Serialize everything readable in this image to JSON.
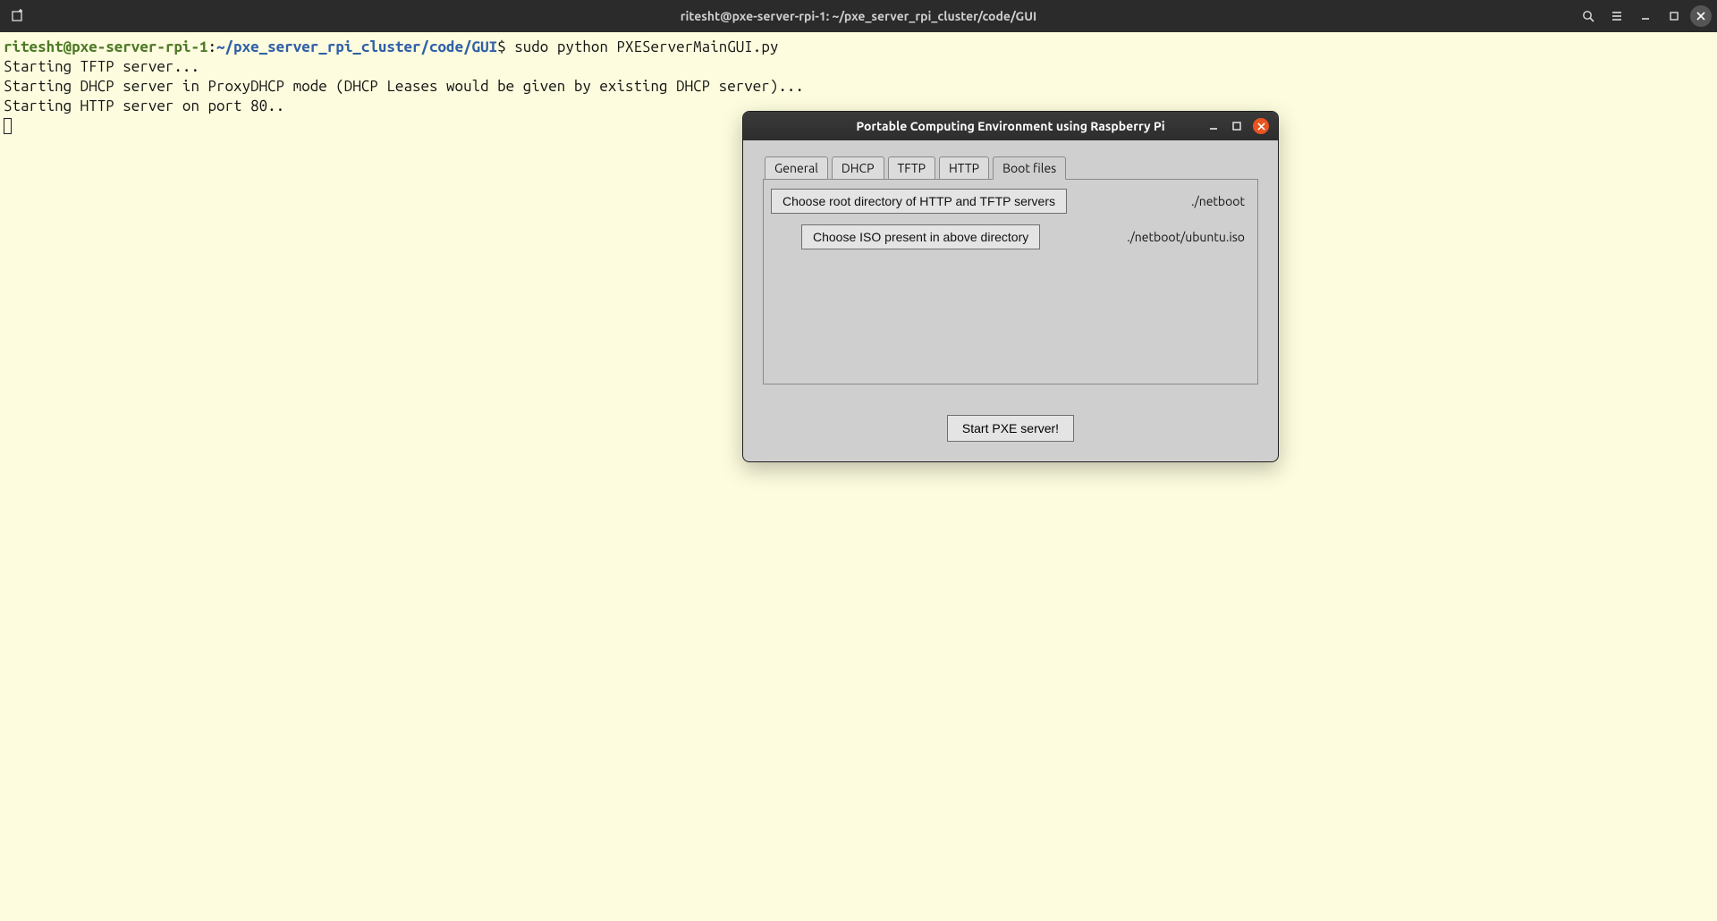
{
  "terminal": {
    "title": "ritesht@pxe-server-rpi-1: ~/pxe_server_rpi_cluster/code/GUI",
    "prompt_user": "ritesht@pxe-server-rpi-1",
    "prompt_sep": ":",
    "prompt_path": "~/pxe_server_rpi_cluster/code/GUI",
    "prompt_symbol": "$",
    "command": " sudo python PXEServerMainGUI.py",
    "lines": [
      "Starting TFTP server...",
      "Starting DHCP server in ProxyDHCP mode (DHCP Leases would be given by existing DHCP server)...",
      "Starting HTTP server on port 80.."
    ]
  },
  "gui": {
    "title": "Portable Computing Environment using Raspberry Pi",
    "tabs": [
      "General",
      "DHCP",
      "TFTP",
      "HTTP",
      "Boot files"
    ],
    "active_tab_index": 4,
    "choose_root_label": "Choose root directory of HTTP and TFTP servers",
    "root_path": "./netboot",
    "choose_iso_label": "Choose ISO present in above directory",
    "iso_path": "./netboot/ubuntu.iso",
    "start_button_label": "Start PXE server!"
  },
  "icons": {
    "new_tab": "new-tab-icon",
    "search": "search-icon",
    "hamburger": "hamburger-icon",
    "minimize": "minimize-icon",
    "maximize": "maximize-icon",
    "close": "close-icon"
  }
}
